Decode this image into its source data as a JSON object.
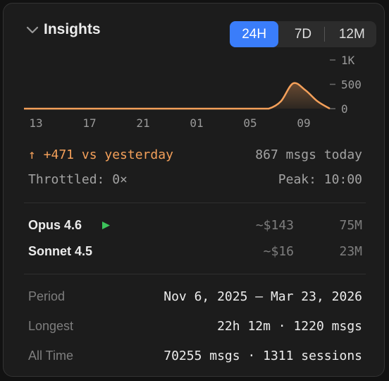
{
  "header": {
    "title": "Insights"
  },
  "range_tabs": [
    {
      "label": "24H",
      "active": true
    },
    {
      "label": "7D",
      "active": false
    },
    {
      "label": "12M",
      "active": false
    }
  ],
  "chart_data": {
    "type": "area",
    "x_ticks": [
      "13",
      "17",
      "21",
      "01",
      "05",
      "09"
    ],
    "y_ticks": [
      "1K",
      "500",
      "0"
    ],
    "ylim": [
      0,
      1000
    ],
    "color": "#f4a05a",
    "values": [
      0,
      0,
      0,
      0,
      0,
      0,
      0,
      0,
      0,
      0,
      0,
      0,
      0,
      0,
      0,
      0,
      0,
      0,
      0,
      0,
      0,
      150,
      520,
      380,
      150,
      0
    ]
  },
  "summary": {
    "delta": "↑ +471 vs yesterday",
    "today": "867 msgs today",
    "throttled": "Throttled: 0×",
    "peak": "Peak: 10:00"
  },
  "models": [
    {
      "name": "Opus 4.6",
      "cost": "~$143",
      "tokens": "75M",
      "playing": true
    },
    {
      "name": "Sonnet 4.5",
      "cost": "~$16",
      "tokens": "23M",
      "playing": false
    }
  ],
  "stats": {
    "period_label": "Period",
    "period_value": "Nov 6, 2025 — Mar 23, 2026",
    "longest_label": "Longest",
    "longest_value": "22h 12m · 1220 msgs",
    "alltime_label": "All Time",
    "alltime_value": "70255 msgs · 1311 sessions"
  },
  "colors": {
    "accent": "#3a7dfa",
    "orange": "#f4a05a",
    "green": "#3cc35a"
  }
}
